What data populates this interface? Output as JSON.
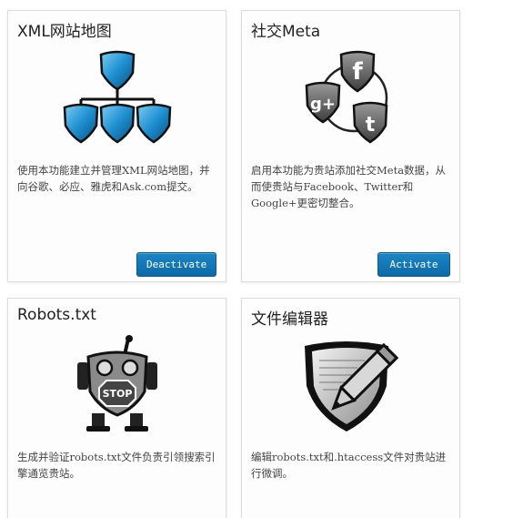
{
  "modules": [
    {
      "title": "XML网站地图",
      "icon": "sitemap-icon",
      "description": "使用本功能建立并管理XML网站地图，并向谷歌、必应、雅虎和Ask.com提交。",
      "button_label": "Deactivate"
    },
    {
      "title": "社交Meta",
      "icon": "social-meta-icon",
      "description": "启用本功能为贵站添加社交Meta数据，从而使贵站与Facebook、Twitter和Google+更密切整合。",
      "button_label": "Activate"
    },
    {
      "title": "Robots.txt",
      "icon": "robot-stop-icon",
      "description": "生成并验证robots.txt文件负责引领搜索引擎通览贵站。"
    },
    {
      "title": "文件编辑器",
      "icon": "file-editor-icon",
      "description": "编辑robots.txt和.htaccess文件对贵站进行微调。"
    }
  ],
  "colors": {
    "button": "#0c6aa6",
    "shield_blue": "#1e8fd0"
  }
}
